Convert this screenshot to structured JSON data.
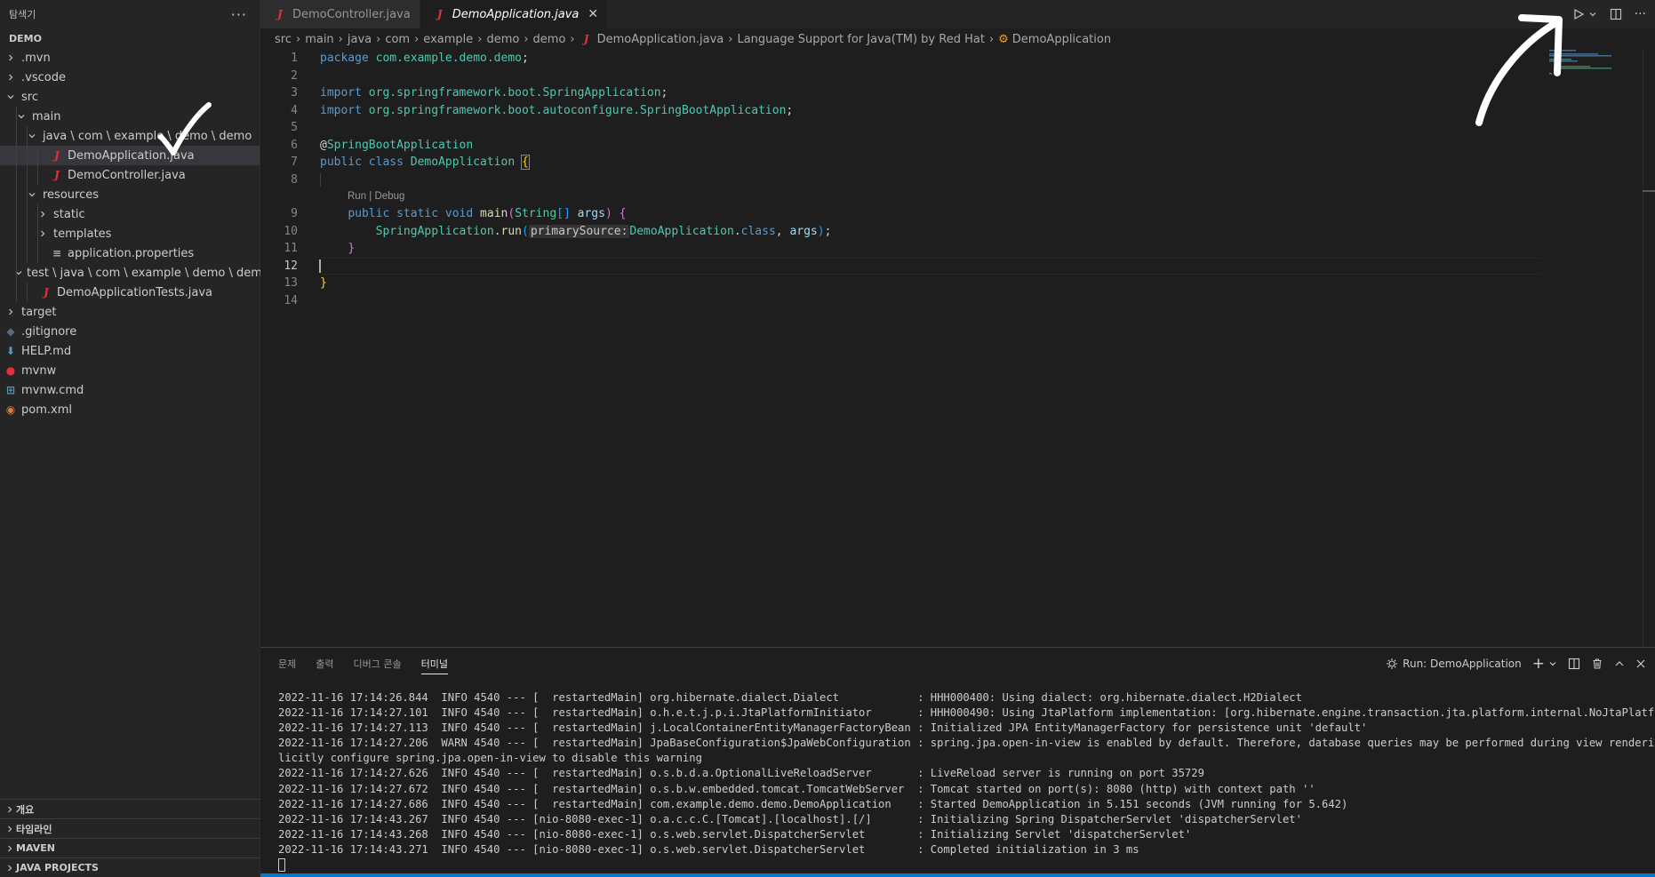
{
  "sidebar": {
    "header": "탐색기",
    "header_actions": "···",
    "root": "DEMO",
    "tree": [
      {
        "label": ".mvn",
        "kind": "folder-closed",
        "depth": 0
      },
      {
        "label": ".vscode",
        "kind": "folder-closed",
        "depth": 0
      },
      {
        "label": "src",
        "kind": "folder-open",
        "depth": 0
      },
      {
        "label": "main",
        "kind": "folder-open",
        "depth": 1
      },
      {
        "label": "java \\ com \\ example \\ demo \\ demo",
        "kind": "folder-open",
        "depth": 2
      },
      {
        "label": "DemoApplication.java",
        "kind": "java",
        "depth": 3,
        "selected": true
      },
      {
        "label": "DemoController.java",
        "kind": "java",
        "depth": 3
      },
      {
        "label": "resources",
        "kind": "folder-open",
        "depth": 2
      },
      {
        "label": "static",
        "kind": "folder-closed",
        "depth": 3
      },
      {
        "label": "templates",
        "kind": "folder-closed",
        "depth": 3
      },
      {
        "label": "application.properties",
        "kind": "props",
        "depth": 3
      },
      {
        "label": "test \\ java \\ com \\ example \\ demo \\ demo",
        "kind": "folder-open",
        "depth": 1
      },
      {
        "label": "DemoApplicationTests.java",
        "kind": "java",
        "depth": 2
      },
      {
        "label": "target",
        "kind": "folder-closed",
        "depth": 0
      },
      {
        "label": ".gitignore",
        "kind": "git",
        "depth": 0
      },
      {
        "label": "HELP.md",
        "kind": "md",
        "depth": 0
      },
      {
        "label": "mvnw",
        "kind": "mvnw",
        "depth": 0
      },
      {
        "label": "mvnw.cmd",
        "kind": "win",
        "depth": 0
      },
      {
        "label": "pom.xml",
        "kind": "rss",
        "depth": 0
      }
    ],
    "bottom_sections": [
      "개요",
      "타임라인",
      "MAVEN",
      "JAVA PROJECTS"
    ]
  },
  "tabs": [
    {
      "label": "DemoController.java",
      "active": false
    },
    {
      "label": "DemoApplication.java",
      "active": true,
      "close": "✕"
    }
  ],
  "breadcrumbs": [
    "src",
    "main",
    "java",
    "com",
    "example",
    "demo",
    "demo",
    "DemoApplication.java",
    "Language Support for Java(TM) by Red Hat",
    "DemoApplication"
  ],
  "code": {
    "line_numbers": [
      "1",
      "2",
      "3",
      "4",
      "5",
      "6",
      "7",
      "8",
      "9",
      "10",
      "11",
      "12",
      "13",
      "14"
    ],
    "package_kw": "package",
    "package_name": "com.example.demo.demo",
    "import_kw": "import",
    "import1": "org.springframework.boot.SpringApplication",
    "import2": "org.springframework.boot.autoconfigure.SpringBootApplication",
    "at": "@",
    "annotation": "SpringBootApplication",
    "public_kw": "public",
    "class_kw": "class",
    "class_name": "DemoApplication",
    "codelens": "Run | Debug",
    "static_kw": "static",
    "void_kw": "void",
    "main_fn": "main",
    "string_type": "String",
    "args": "args",
    "spring_app": "SpringApplication",
    "run_fn": "run",
    "hint": "primarySource:",
    "class_ref": "DemoApplication",
    "class_kw2": "class"
  },
  "panel": {
    "tabs": [
      "문제",
      "출력",
      "디버그 콘솔",
      "터미널"
    ],
    "active_tab": "터미널",
    "run_label": "Run: DemoApplication",
    "terminal_lines": [
      "2022-11-16 17:14:26.844  INFO 4540 --- [  restartedMain] org.hibernate.dialect.Dialect            : HHH000400: Using dialect: org.hibernate.dialect.H2Dialect",
      "2022-11-16 17:14:27.101  INFO 4540 --- [  restartedMain] o.h.e.t.j.p.i.JtaPlatformInitiator       : HHH000490: Using JtaPlatform implementation: [org.hibernate.engine.transaction.jta.platform.internal.NoJtaPlatform]",
      "2022-11-16 17:14:27.113  INFO 4540 --- [  restartedMain] j.LocalContainerEntityManagerFactoryBean : Initialized JPA EntityManagerFactory for persistence unit 'default'",
      "2022-11-16 17:14:27.206  WARN 4540 --- [  restartedMain] JpaBaseConfiguration$JpaWebConfiguration : spring.jpa.open-in-view is enabled by default. Therefore, database queries may be performed during view rendering. Exp",
      "licitly configure spring.jpa.open-in-view to disable this warning",
      "2022-11-16 17:14:27.626  INFO 4540 --- [  restartedMain] o.s.b.d.a.OptionalLiveReloadServer       : LiveReload server is running on port 35729",
      "2022-11-16 17:14:27.672  INFO 4540 --- [  restartedMain] o.s.b.w.embedded.tomcat.TomcatWebServer  : Tomcat started on port(s): 8080 (http) with context path ''",
      "2022-11-16 17:14:27.686  INFO 4540 --- [  restartedMain] com.example.demo.demo.DemoApplication    : Started DemoApplication in 5.151 seconds (JVM running for 5.642)",
      "2022-11-16 17:14:43.267  INFO 4540 --- [nio-8080-exec-1] o.a.c.c.C.[Tomcat].[localhost].[/]       : Initializing Spring DispatcherServlet 'dispatcherServlet'",
      "2022-11-16 17:14:43.268  INFO 4540 --- [nio-8080-exec-1] o.s.web.servlet.DispatcherServlet        : Initializing Servlet 'dispatcherServlet'",
      "2022-11-16 17:14:43.271  INFO 4540 --- [nio-8080-exec-1] o.s.web.servlet.DispatcherServlet        : Completed initialization in 3 ms"
    ]
  },
  "icons": {
    "run": "play-icon",
    "split": "split-editor-icon",
    "more": "more-icon",
    "add": "plus-icon",
    "trash": "trash-icon",
    "maximize": "chevron-up-icon",
    "close": "close-icon",
    "debug": "gear-icon"
  },
  "colors": {
    "accent": "#007acc",
    "java_icon": "#e0313b",
    "annotation_marks": "#ffffff"
  }
}
